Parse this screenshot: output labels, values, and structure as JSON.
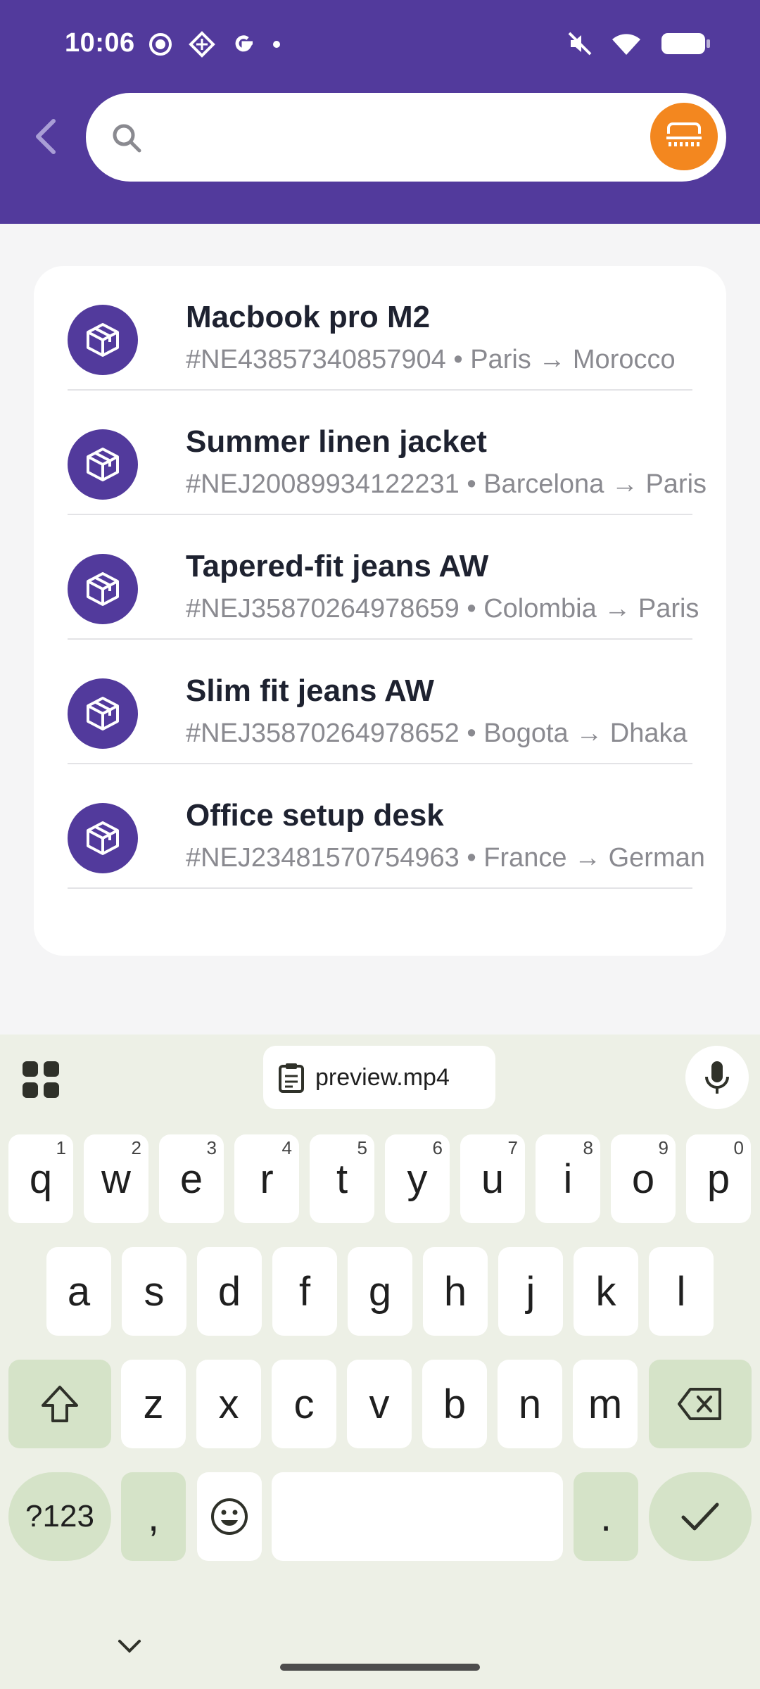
{
  "status_bar": {
    "time": "10:06"
  },
  "search": {
    "placeholder": "",
    "value": ""
  },
  "shipments": [
    {
      "title": "Macbook pro M2",
      "subtitle": "#NE43857340857904 • Paris → Morocco"
    },
    {
      "title": "Summer linen jacket",
      "subtitle": "#NEJ20089934122231 • Barcelona → Paris"
    },
    {
      "title": "Tapered-fit jeans AW",
      "subtitle": "#NEJ35870264978659 • Colombia → Paris"
    },
    {
      "title": "Slim fit jeans AW",
      "subtitle": "#NEJ35870264978652 • Bogota → Dhaka"
    },
    {
      "title": "Office setup desk",
      "subtitle": "#NEJ23481570754963 • France → German"
    }
  ],
  "keyboard": {
    "clipboard_chip": "preview.mp4",
    "row1": [
      {
        "k": "q",
        "h": "1"
      },
      {
        "k": "w",
        "h": "2"
      },
      {
        "k": "e",
        "h": "3"
      },
      {
        "k": "r",
        "h": "4"
      },
      {
        "k": "t",
        "h": "5"
      },
      {
        "k": "y",
        "h": "6"
      },
      {
        "k": "u",
        "h": "7"
      },
      {
        "k": "i",
        "h": "8"
      },
      {
        "k": "o",
        "h": "9"
      },
      {
        "k": "p",
        "h": "0"
      }
    ],
    "row2": [
      "a",
      "s",
      "d",
      "f",
      "g",
      "h",
      "j",
      "k",
      "l"
    ],
    "row3": [
      "z",
      "x",
      "c",
      "v",
      "b",
      "n",
      "m"
    ],
    "symbols_key": "?123",
    "comma_key": ",",
    "period_key": "."
  },
  "colors": {
    "brand": "#523a9c",
    "accent": "#f3871f"
  }
}
